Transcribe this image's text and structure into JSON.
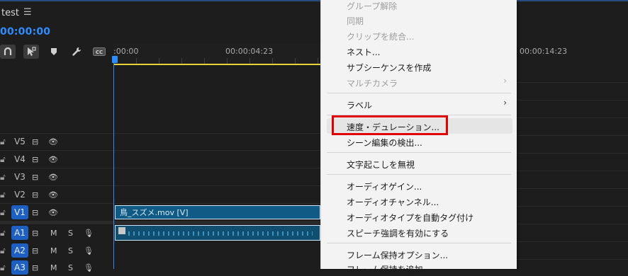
{
  "sequence": {
    "title": "test",
    "menu_icon": "☰",
    "timecode": "00:00:00"
  },
  "toolbar": {
    "icons": [
      "snap-magnet-icon",
      "linked-selection-icon",
      "marker-icon",
      "wrench-icon",
      "captions-icon"
    ],
    "cc_label": "CC"
  },
  "ruler": {
    "ticks": [
      ":00:00",
      "00:00:04:23",
      "00:00:14:23"
    ]
  },
  "tracks": {
    "video": [
      {
        "name": "V5",
        "target": false
      },
      {
        "name": "V4",
        "target": false
      },
      {
        "name": "V3",
        "target": false
      },
      {
        "name": "V2",
        "target": false
      },
      {
        "name": "V1",
        "target": true
      }
    ],
    "audio": [
      {
        "name": "A1",
        "target": true,
        "m": "M",
        "s": "S"
      },
      {
        "name": "A2",
        "target": true,
        "m": "M",
        "s": "S"
      },
      {
        "name": "A3",
        "target": true,
        "m": "M",
        "s": "S"
      }
    ]
  },
  "clips": {
    "v1_label": "鳥_スズメ.mov [V]"
  },
  "menu": {
    "items": [
      {
        "label": "グループ解除",
        "disabled": true
      },
      {
        "label": "同期",
        "disabled": true
      },
      {
        "label": "クリップを統合...",
        "disabled": true
      },
      {
        "label": "ネスト...",
        "disabled": false
      },
      {
        "label": "サブシーケンスを作成",
        "disabled": false
      },
      {
        "label": "マルチカメラ",
        "disabled": true,
        "submenu": true
      },
      {
        "label": "ラベル",
        "disabled": false,
        "submenu": true
      },
      {
        "label": "速度・デュレーション...",
        "disabled": false,
        "highlighted": true
      },
      {
        "label": "シーン編集の検出...",
        "disabled": false
      },
      {
        "label": "文字起こしを無視",
        "disabled": false
      },
      {
        "label": "オーディオゲイン...",
        "disabled": false
      },
      {
        "label": "オーディオチャンネル...",
        "disabled": false
      },
      {
        "label": "オーディオタイプを自動タグ付け",
        "disabled": false
      },
      {
        "label": "スピーチ強調を有効にする",
        "disabled": false
      },
      {
        "label": "フレーム保持オプション...",
        "disabled": false
      },
      {
        "label": "フレーム保持を追加",
        "disabled": false
      }
    ],
    "submenu_arrow": "›"
  },
  "colors": {
    "accent": "#2f8cff",
    "target_track": "#1e5fc2",
    "clip": "#0f5b86",
    "highlight_box": "#e10000"
  }
}
